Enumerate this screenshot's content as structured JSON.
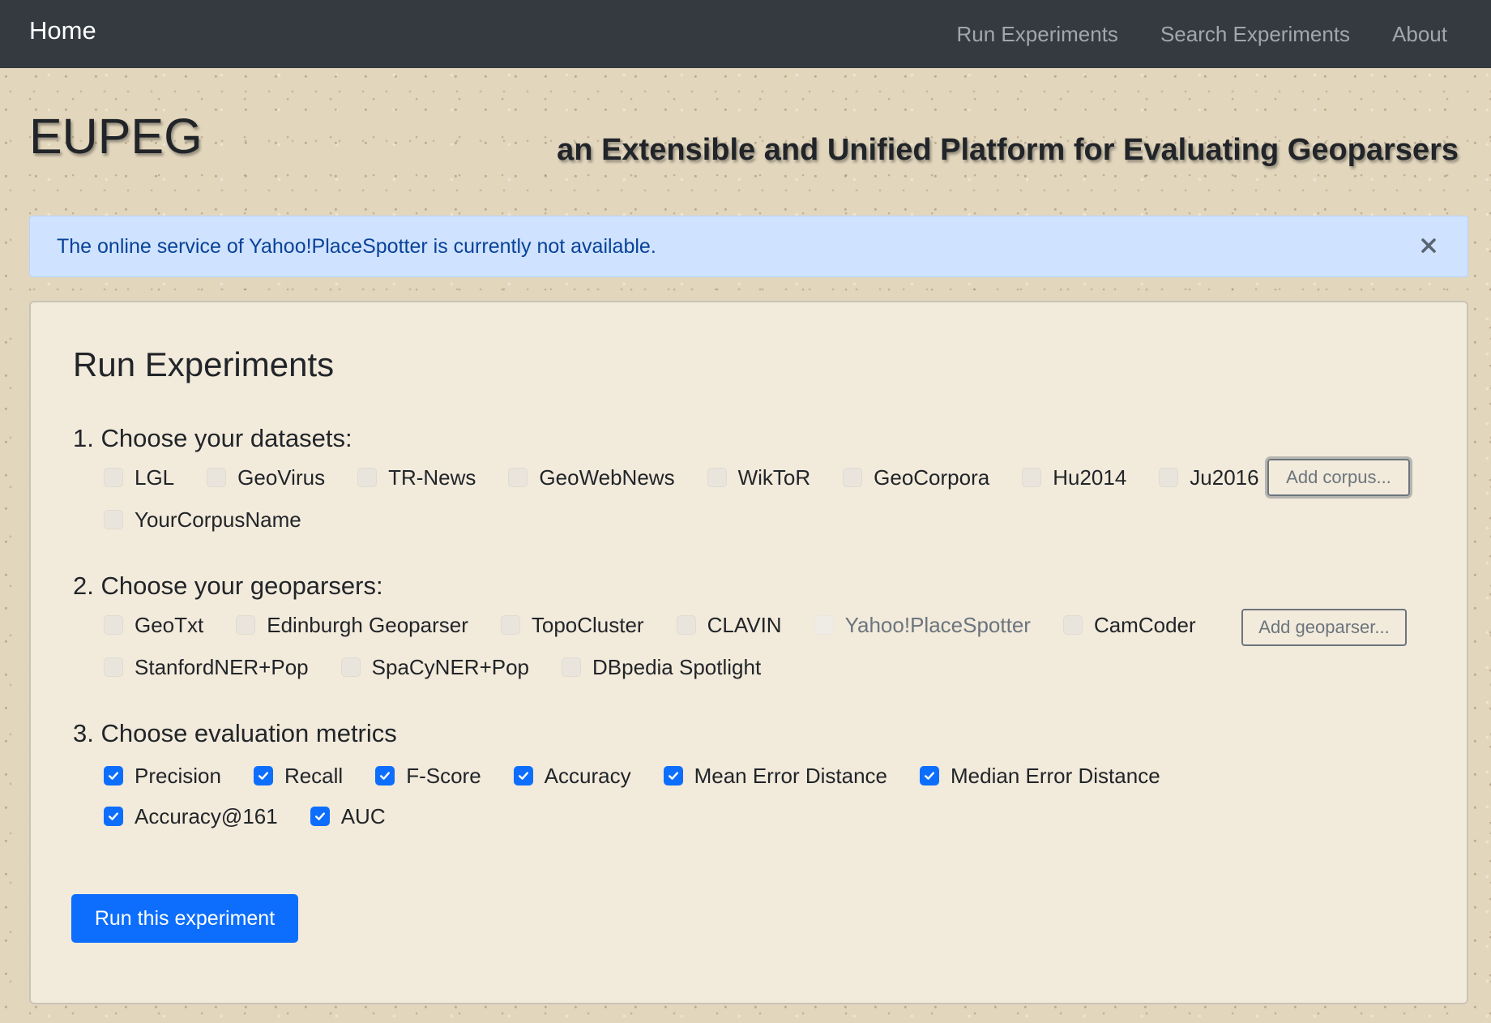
{
  "navbar": {
    "brand": "Home",
    "links": [
      "Run Experiments",
      "Search Experiments",
      "About"
    ]
  },
  "header": {
    "title": "EUPEG",
    "subtitle": "an Extensible and Unified Platform for Evaluating Geoparsers"
  },
  "alert": {
    "text": "The online service of Yahoo!PlaceSpotter is currently not available.",
    "close_icon": "close-icon"
  },
  "card": {
    "title": "Run Experiments",
    "datasets": {
      "label": "1. Choose your datasets:",
      "items": [
        "LGL",
        "GeoVirus",
        "TR-News",
        "GeoWebNews",
        "WikToR",
        "GeoCorpora",
        "Hu2014",
        "Ju2016",
        "YourCorpusName"
      ],
      "add_button": "Add corpus..."
    },
    "geoparsers": {
      "label": "2. Choose your geoparsers:",
      "items": [
        "GeoTxt",
        "Edinburgh Geoparser",
        "TopoCluster",
        "CLAVIN",
        "Yahoo!PlaceSpotter",
        "CamCoder",
        "StanfordNER+Pop",
        "SpaCyNER+Pop",
        "DBpedia Spotlight"
      ],
      "disabled": [
        "Yahoo!PlaceSpotter"
      ],
      "add_button": "Add geoparser..."
    },
    "metrics": {
      "label": "3. Choose evaluation metrics",
      "items": [
        "Precision",
        "Recall",
        "F-Score",
        "Accuracy",
        "Mean Error Distance",
        "Median Error Distance",
        "Accuracy@161",
        "AUC"
      ],
      "checked": true
    },
    "run_button": "Run this experiment"
  },
  "colors": {
    "navbar": "#343a40",
    "primary": "#0d6efd",
    "alert_bg": "#cfe2ff",
    "alert_text": "#084298"
  }
}
